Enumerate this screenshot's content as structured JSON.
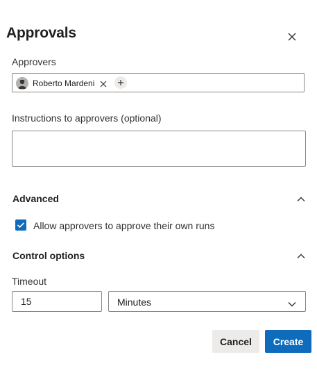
{
  "dialog": {
    "title": "Approvals",
    "close_icon": "close-icon"
  },
  "approvers": {
    "label": "Approvers",
    "items": [
      {
        "name": "Roberto Mardeni",
        "avatar_icon": "user-avatar-icon",
        "remove_icon": "close-icon"
      }
    ],
    "add_icon": "plus-icon"
  },
  "instructions": {
    "label": "Instructions to approvers (optional)",
    "value": "",
    "placeholder": ""
  },
  "advanced": {
    "title": "Advanced",
    "chevron_icon": "chevron-up-icon",
    "allow_self_approve": {
      "label": "Allow approvers to approve their own runs",
      "checked": true
    }
  },
  "control_options": {
    "title": "Control options",
    "chevron_icon": "chevron-up-icon",
    "timeout": {
      "label": "Timeout",
      "value": "15",
      "unit": "Minutes",
      "unit_icon": "chevron-down-icon"
    }
  },
  "footer": {
    "cancel_label": "Cancel",
    "create_label": "Create"
  },
  "colors": {
    "accent": "#0f6cbd",
    "secondary_button": "#edebe9",
    "border": "#8a8886"
  }
}
